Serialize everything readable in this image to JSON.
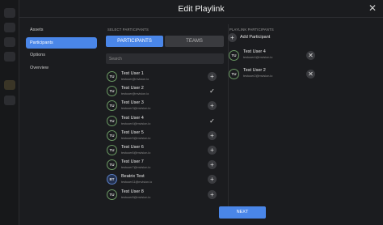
{
  "modal": {
    "title": "Edit Playlink",
    "close_glyph": "✕",
    "next_label": "NEXT"
  },
  "nav": {
    "items": [
      {
        "label": "Assets",
        "active": false
      },
      {
        "label": "Participants",
        "active": true
      },
      {
        "label": "Options",
        "active": false
      },
      {
        "label": "Overview",
        "active": false
      }
    ]
  },
  "select": {
    "section_label": "SELECT PARTICIPANTS",
    "tabs": {
      "participants": "PARTICIPANTS",
      "teams": "TEAMS"
    },
    "search_placeholder": "Search",
    "rows": [
      {
        "initials": "TU",
        "name": "Test User 1",
        "email": "testuser@mvision.io",
        "action": "+"
      },
      {
        "initials": "TU",
        "name": "Test User 2",
        "email": "testuser@mvision.io",
        "action": "✓"
      },
      {
        "initials": "TU",
        "name": "Test User 3",
        "email": "testuser3@mvision.io",
        "action": "+"
      },
      {
        "initials": "TU",
        "name": "Test User 4",
        "email": "testuser4@mvision.io",
        "action": "✓"
      },
      {
        "initials": "TU",
        "name": "Test User 5",
        "email": "testuser5@mvision.io",
        "action": "+"
      },
      {
        "initials": "TU",
        "name": "Test User 6",
        "email": "testuser6@mvision.io",
        "action": "+"
      },
      {
        "initials": "TU",
        "name": "Test User 7",
        "email": "testuser7@mvision.io",
        "action": "+"
      },
      {
        "initials": "BT",
        "name": "Beatrix Test",
        "email": "testuser11@mvision.io",
        "action": "+"
      },
      {
        "initials": "TU",
        "name": "Test User 8",
        "email": "testuser8@mvision.io",
        "action": "+"
      }
    ]
  },
  "playlink": {
    "section_label": "PLAYLINK PARTICIPANTS",
    "add_label": "Add Participant",
    "add_glyph": "+",
    "remove_glyph": "✕",
    "participants": [
      {
        "initials": "TU",
        "name": "Test User 4",
        "email": "testuser4@mvision.io"
      },
      {
        "initials": "TU",
        "name": "Test User 2",
        "email": "testuser2@mvision.io"
      }
    ]
  },
  "colors": {
    "accent": "#4a86e8",
    "background": "#1b1c1f",
    "avatar_ring": "#6b9a63"
  },
  "icons": {
    "add": "plus-icon",
    "check": "check-icon",
    "remove": "close-icon"
  }
}
